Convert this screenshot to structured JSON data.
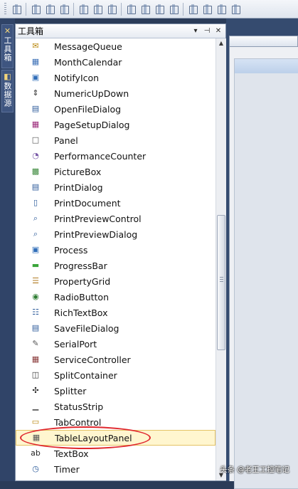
{
  "toolbox": {
    "title": "工具箱",
    "header_buttons": {
      "dropdown": "▾",
      "pin": "⊣",
      "close": "✕"
    },
    "items": [
      {
        "label": "MessageQueue",
        "icon": "message-queue-icon",
        "glyph": "✉",
        "color": "#b8860b"
      },
      {
        "label": "MonthCalendar",
        "icon": "month-calendar-icon",
        "glyph": "▦",
        "color": "#3b6fb6"
      },
      {
        "label": "NotifyIcon",
        "icon": "notify-icon-icon",
        "glyph": "▣",
        "color": "#2f6db8"
      },
      {
        "label": "NumericUpDown",
        "icon": "numeric-updown-icon",
        "glyph": "⇕",
        "color": "#333333"
      },
      {
        "label": "OpenFileDialog",
        "icon": "open-file-dialog-icon",
        "glyph": "▤",
        "color": "#2b5a9a"
      },
      {
        "label": "PageSetupDialog",
        "icon": "page-setup-dialog-icon",
        "glyph": "▦",
        "color": "#9b2a7a"
      },
      {
        "label": "Panel",
        "icon": "panel-icon",
        "glyph": "□",
        "color": "#555555"
      },
      {
        "label": "PerformanceCounter",
        "icon": "performance-counter-icon",
        "glyph": "◔",
        "color": "#7a5aa8"
      },
      {
        "label": "PictureBox",
        "icon": "picture-box-icon",
        "glyph": "▩",
        "color": "#3d8a3d"
      },
      {
        "label": "PrintDialog",
        "icon": "print-dialog-icon",
        "glyph": "▤",
        "color": "#2b5a9a"
      },
      {
        "label": "PrintDocument",
        "icon": "print-document-icon",
        "glyph": "▯",
        "color": "#2b5a9a"
      },
      {
        "label": "PrintPreviewControl",
        "icon": "print-preview-control-icon",
        "glyph": "⌕",
        "color": "#2b5a9a"
      },
      {
        "label": "PrintPreviewDialog",
        "icon": "print-preview-dialog-icon",
        "glyph": "⌕",
        "color": "#2b5a9a"
      },
      {
        "label": "Process",
        "icon": "process-icon",
        "glyph": "▣",
        "color": "#2f6db8"
      },
      {
        "label": "ProgressBar",
        "icon": "progress-bar-icon",
        "glyph": "▬",
        "color": "#3aa53a"
      },
      {
        "label": "PropertyGrid",
        "icon": "property-grid-icon",
        "glyph": "☰",
        "color": "#b07a20"
      },
      {
        "label": "RadioButton",
        "icon": "radio-button-icon",
        "glyph": "◉",
        "color": "#2e7d32"
      },
      {
        "label": "RichTextBox",
        "icon": "rich-text-box-icon",
        "glyph": "☷",
        "color": "#2b5a9a"
      },
      {
        "label": "SaveFileDialog",
        "icon": "save-file-dialog-icon",
        "glyph": "▤",
        "color": "#2b5a9a"
      },
      {
        "label": "SerialPort",
        "icon": "serial-port-icon",
        "glyph": "✎",
        "color": "#555555"
      },
      {
        "label": "ServiceController",
        "icon": "service-controller-icon",
        "glyph": "▦",
        "color": "#8a3a3a"
      },
      {
        "label": "SplitContainer",
        "icon": "split-container-icon",
        "glyph": "◫",
        "color": "#333333"
      },
      {
        "label": "Splitter",
        "icon": "splitter-icon",
        "glyph": "✣",
        "color": "#222222"
      },
      {
        "label": "StatusStrip",
        "icon": "status-strip-icon",
        "glyph": "▁",
        "color": "#555555"
      },
      {
        "label": "TabControl",
        "icon": "tab-control-icon",
        "glyph": "▭",
        "color": "#b8860b"
      },
      {
        "label": "TableLayoutPanel",
        "icon": "table-layout-panel-icon",
        "glyph": "▦",
        "color": "#555555",
        "selected": true
      },
      {
        "label": "TextBox",
        "icon": "text-box-icon",
        "glyph": "ab",
        "color": "#222222"
      },
      {
        "label": "Timer",
        "icon": "timer-icon",
        "glyph": "◷",
        "color": "#2b5a9a"
      }
    ]
  },
  "side_tabs": [
    {
      "label": "工具箱",
      "icon": "toolbox-icon"
    },
    {
      "label": "数据源",
      "icon": "data-source-icon"
    }
  ],
  "watermark": "头条 @老王工控笔记"
}
